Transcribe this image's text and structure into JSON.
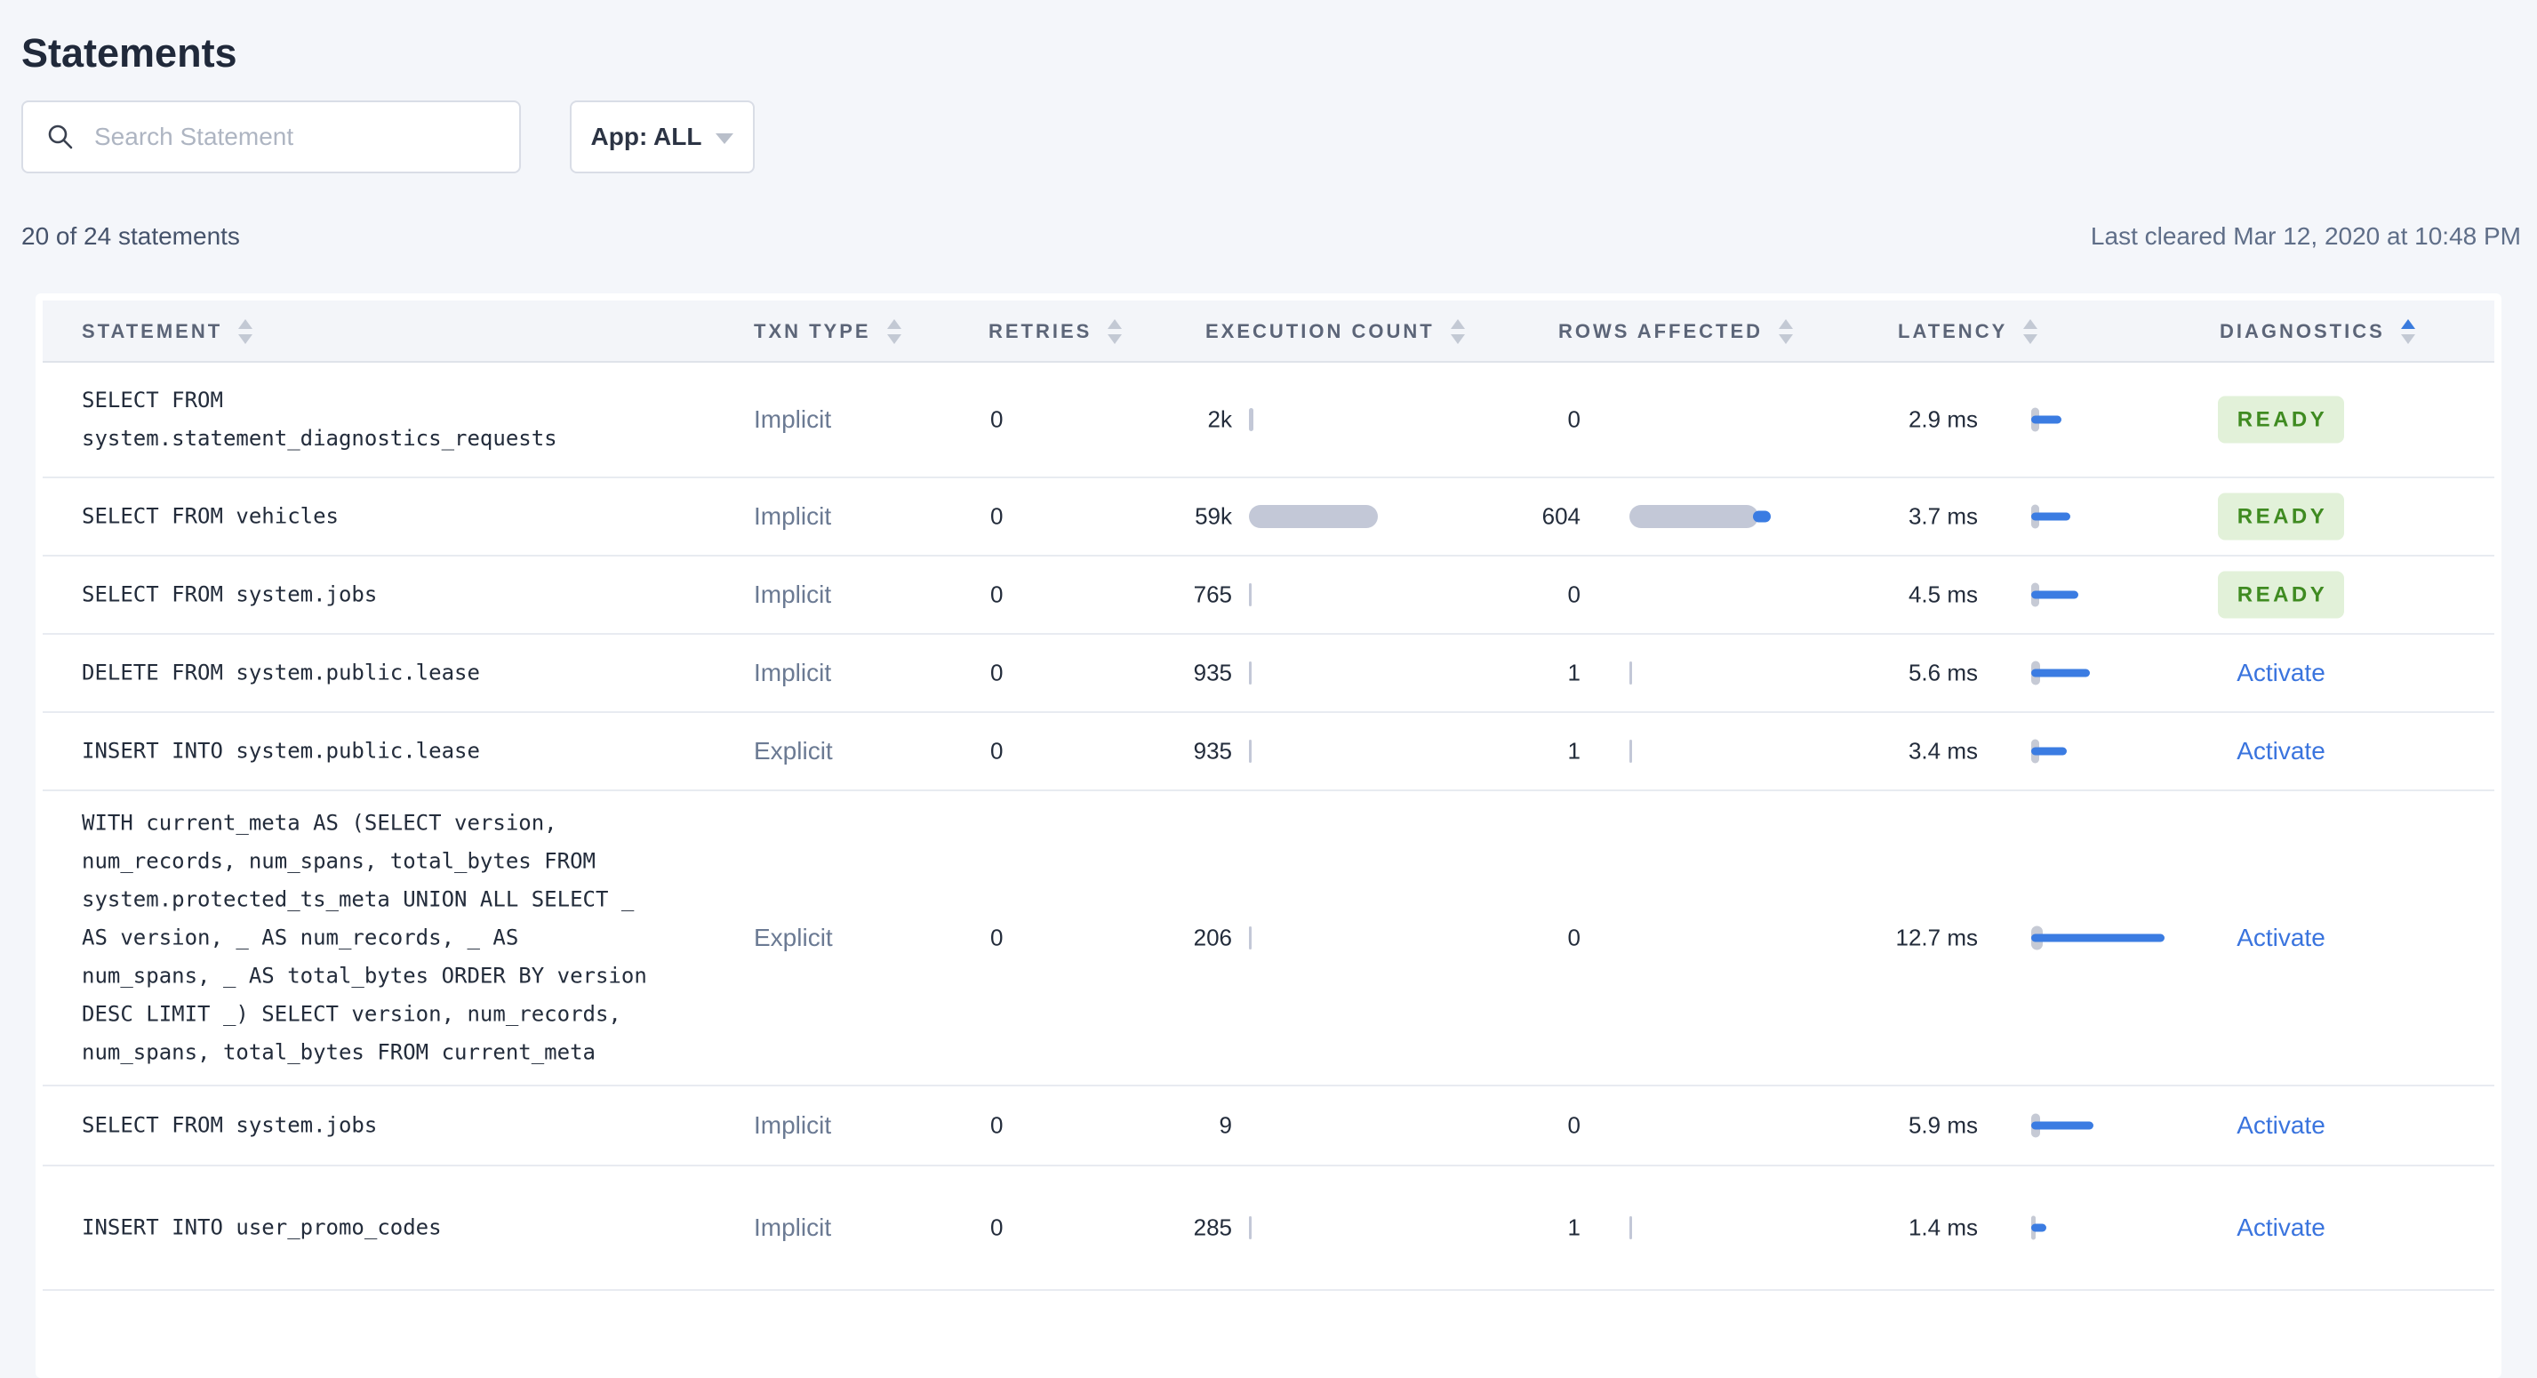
{
  "header": {
    "title": "Statements"
  },
  "toolbar": {
    "search_placeholder": "Search Statement",
    "app_filter_label": "App: ALL"
  },
  "summary": {
    "count_text": "20 of 24 statements",
    "last_cleared": "Last cleared Mar 12, 2020 at 10:48 PM"
  },
  "table": {
    "columns": [
      {
        "label": "STATEMENT"
      },
      {
        "label": "TXN TYPE"
      },
      {
        "label": "RETRIES"
      },
      {
        "label": "EXECUTION COUNT"
      },
      {
        "label": "ROWS AFFECTED"
      },
      {
        "label": "LATENCY"
      },
      {
        "label": "DIAGNOSTICS",
        "sort_active": "asc"
      }
    ],
    "bar_max": {
      "execution_count": 59000,
      "rows_affected": 604,
      "latency_ms": 12.7
    },
    "rows": [
      {
        "statement_lines": [
          "SELECT FROM",
          "system.statement_diagnostics_requests"
        ],
        "txn_type": "Implicit",
        "retries": "0",
        "execution_count": {
          "label": "2k",
          "value": 2000
        },
        "rows_affected": {
          "label": "0",
          "value": 0
        },
        "latency": {
          "label": "2.9 ms",
          "value": 2.9,
          "spread": 9
        },
        "diagnostics": {
          "type": "badge",
          "label": "READY"
        }
      },
      {
        "statement_lines": [
          "SELECT FROM vehicles"
        ],
        "txn_type": "Implicit",
        "retries": "0",
        "execution_count": {
          "label": "59k",
          "value": 59000
        },
        "rows_affected": {
          "label": "604",
          "value": 604
        },
        "latency": {
          "label": "3.7 ms",
          "value": 3.7,
          "spread": 9
        },
        "diagnostics": {
          "type": "badge",
          "label": "READY"
        }
      },
      {
        "statement_lines": [
          "SELECT FROM system.jobs"
        ],
        "txn_type": "Implicit",
        "retries": "0",
        "execution_count": {
          "label": "765",
          "value": 765
        },
        "rows_affected": {
          "label": "0",
          "value": 0
        },
        "latency": {
          "label": "4.5 ms",
          "value": 4.5,
          "spread": 9
        },
        "diagnostics": {
          "type": "badge",
          "label": "READY"
        }
      },
      {
        "statement_lines": [
          "DELETE FROM system.public.lease"
        ],
        "txn_type": "Implicit",
        "retries": "0",
        "execution_count": {
          "label": "935",
          "value": 935
        },
        "rows_affected": {
          "label": "1",
          "value": 1
        },
        "latency": {
          "label": "5.6 ms",
          "value": 5.6,
          "spread": 10
        },
        "diagnostics": {
          "type": "link",
          "label": "Activate"
        }
      },
      {
        "statement_lines": [
          "INSERT INTO system.public.lease"
        ],
        "txn_type": "Explicit",
        "retries": "0",
        "execution_count": {
          "label": "935",
          "value": 935
        },
        "rows_affected": {
          "label": "1",
          "value": 1
        },
        "latency": {
          "label": "3.4 ms",
          "value": 3.4,
          "spread": 9
        },
        "diagnostics": {
          "type": "link",
          "label": "Activate"
        }
      },
      {
        "statement_lines": [
          "WITH current_meta AS (SELECT version,",
          "num_records, num_spans, total_bytes FROM",
          "system.protected_ts_meta UNION ALL SELECT _",
          "AS version, _ AS num_records, _ AS",
          "num_spans, _ AS total_bytes ORDER BY version",
          "DESC LIMIT _) SELECT version, num_records,",
          "num_spans, total_bytes FROM current_meta"
        ],
        "txn_type": "Explicit",
        "retries": "0",
        "execution_count": {
          "label": "206",
          "value": 206
        },
        "rows_affected": {
          "label": "0",
          "value": 0
        },
        "latency": {
          "label": "12.7 ms",
          "value": 12.7,
          "spread": 13
        },
        "diagnostics": {
          "type": "link",
          "label": "Activate"
        }
      },
      {
        "statement_lines": [
          "SELECT FROM system.jobs"
        ],
        "txn_type": "Implicit",
        "retries": "0",
        "execution_count": {
          "label": "9",
          "value": 9
        },
        "rows_affected": {
          "label": "0",
          "value": 0
        },
        "latency": {
          "label": "5.9 ms",
          "value": 5.9,
          "spread": 10
        },
        "diagnostics": {
          "type": "link",
          "label": "Activate"
        }
      },
      {
        "statement_lines": [
          "INSERT INTO user_promo_codes"
        ],
        "txn_type": "Implicit",
        "retries": "0",
        "execution_count": {
          "label": "285",
          "value": 285
        },
        "rows_affected": {
          "label": "1",
          "value": 1
        },
        "latency": {
          "label": "1.4 ms",
          "value": 1.4,
          "spread": 5
        },
        "diagnostics": {
          "type": "link",
          "label": "Activate"
        }
      }
    ]
  },
  "colors": {
    "accent_blue": "#3b7ce2",
    "bar_gray": "#c3c8d7",
    "ready_text": "#3f8b21",
    "ready_bg": "#e2f1d9",
    "link_blue": "#3a74de",
    "header_text": "#5c6578",
    "page_bg": "#f4f6fa"
  }
}
